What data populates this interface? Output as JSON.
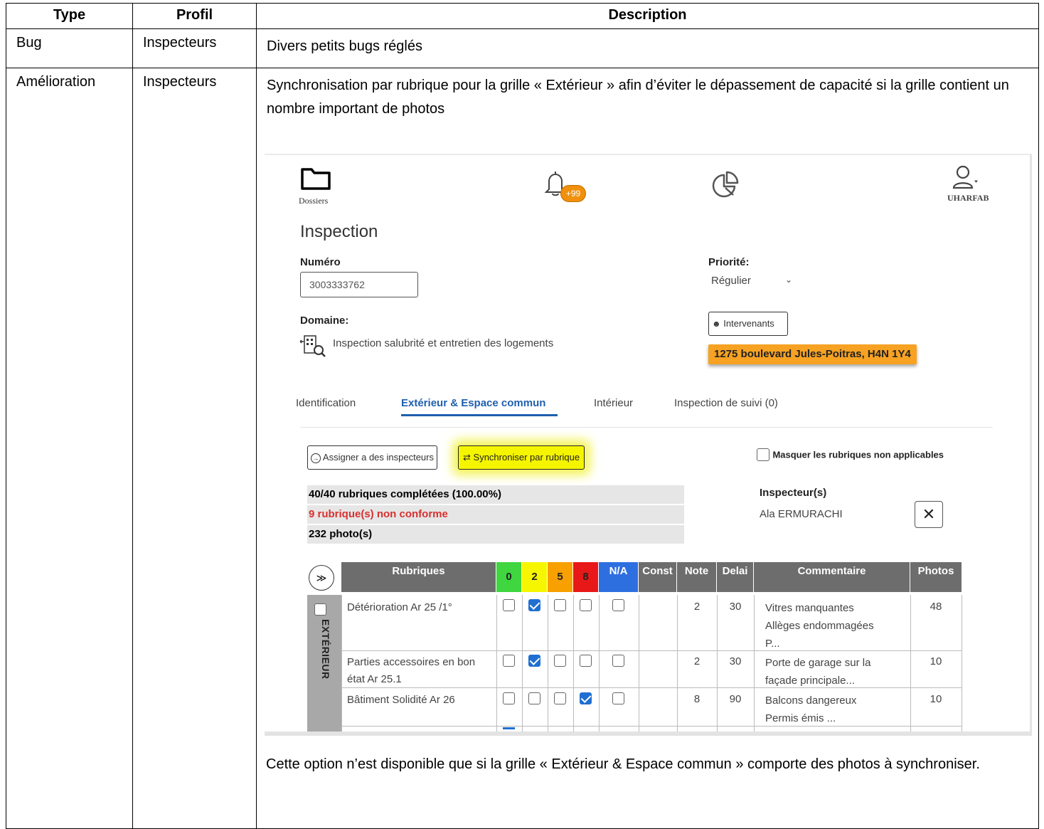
{
  "doc": {
    "headers": {
      "type": "Type",
      "profil": "Profil",
      "description": "Description"
    },
    "rows": [
      {
        "type": "Bug",
        "profil": "Inspecteurs",
        "description": "Divers petits bugs réglés"
      },
      {
        "type": "Amélioration",
        "profil": "Inspecteurs",
        "description": "Synchronisation par rubrique pour la grille « Extérieur » afin d’éviter le dépassement de capacité si la grille contient un nombre important de photos",
        "footer": "Cette option n’est disponible que si la grille « Extérieur & Espace commun » comporte des photos à synchroniser."
      }
    ]
  },
  "app": {
    "nav": {
      "dossiers": "Dossiers",
      "notif_count": "+99",
      "user": "UHARFAB"
    },
    "page_title": "Inspection",
    "numero_label": "Numéro",
    "numero_value": "3003333762",
    "priorite_label": "Priorité:",
    "priorite_value": "Régulier",
    "domaine_label": "Domaine:",
    "domaine_value": "Inspection salubrité et entretien des logements",
    "intervenants_label": "Intervenants",
    "address": "1275 boulevard Jules-Poitras, H4N 1Y4",
    "tabs": [
      "Identification",
      "Extérieur & Espace commun",
      "Intérieur",
      "Inspection de suivi (0)"
    ],
    "active_tab": 1,
    "assign_label": "Assigner a des inspecteurs",
    "sync_label": "Synchroniser par rubrique",
    "hide_label": "Masquer les rubriques non applicables",
    "stats": {
      "completed": "40/40 rubriques complétées (100.00%)",
      "nonconform": "9 rubrique(s) non conforme",
      "photos": "232 photo(s)"
    },
    "inspecteurs_label": "Inspecteur(s)",
    "inspecteur_name": "Ala ERMURACHI",
    "grid": {
      "headers": {
        "rubriques": "Rubriques",
        "s0": "0",
        "s2": "2",
        "s5": "5",
        "s8": "8",
        "na": "N/A",
        "const": "Const",
        "note": "Note",
        "delai": "Delai",
        "commentaire": "Commentaire",
        "photos": "Photos"
      },
      "colors": {
        "header": "#6d6d6d",
        "s0": "#3fd63f",
        "s2": "#f6f600",
        "s5": "#f7a000",
        "s8": "#e81818",
        "na": "#2e6fe0"
      },
      "section": "EXTÉRIEUR",
      "rows": [
        {
          "rubrique": "Détérioration Ar 25 /1°",
          "checked": 1,
          "note": "2",
          "delai": "30",
          "commentaire": [
            "Vitres manquantes",
            "Allèges endommagées",
            "P..."
          ],
          "photos": "48"
        },
        {
          "rubrique": "Parties accessoires en bon état Ar 25.1",
          "checked": 1,
          "note": "2",
          "delai": "30",
          "commentaire": [
            "Porte de garage sur la",
            "façade principale..."
          ],
          "photos": "10"
        },
        {
          "rubrique": "Bâtiment Solidité Ar 26",
          "checked": 3,
          "note": "8",
          "delai": "90",
          "commentaire": [
            "Balcons dangereux",
            "Permis émis ..."
          ],
          "photos": "10"
        }
      ]
    }
  }
}
